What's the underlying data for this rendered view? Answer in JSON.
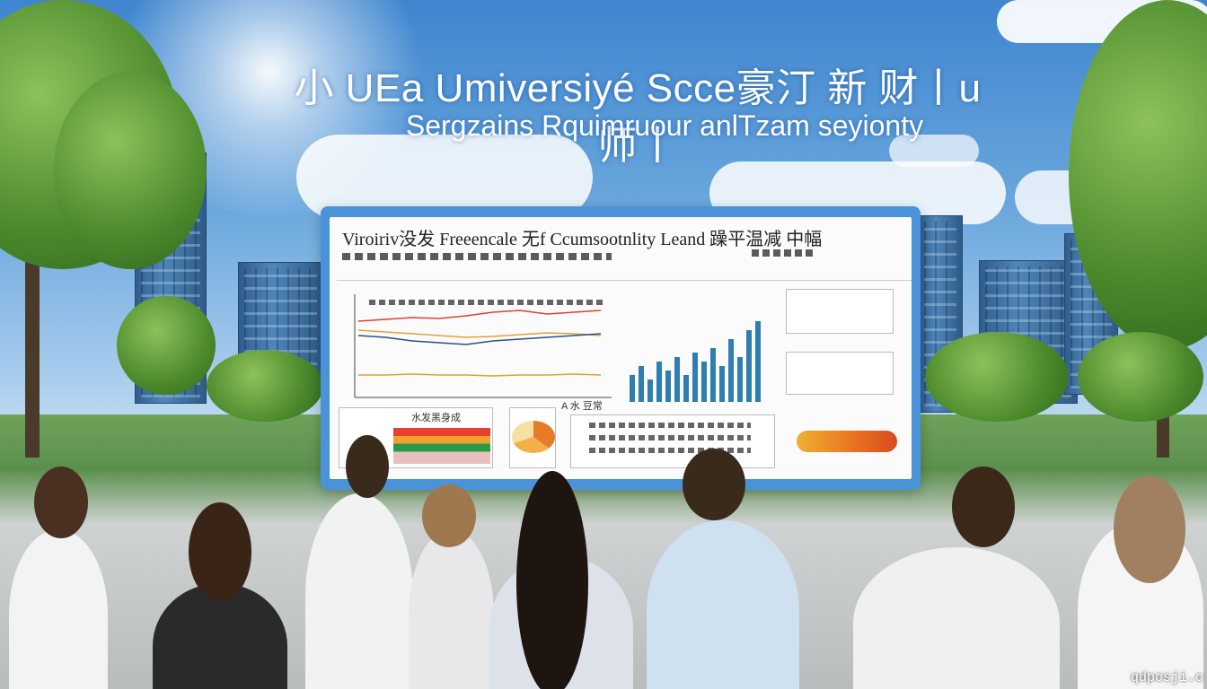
{
  "headline": "小 UEa Umiversiyé Scce豪汀 新 财丨u师丨",
  "subheadline": "Sergzains Rquimruour anlTzam seyionty",
  "board": {
    "heading": "Viroiriv没发 Freeencale 无f Ccumsootnlity  Leand 躁平温减 中幅",
    "panel_bar_label": "水发黑身成",
    "panel_mid_label": "A 水 豆常",
    "line_colors": [
      "#e0402a",
      "#e8a030",
      "#2a4f8a",
      "#d8a820"
    ],
    "bar_color": "#2e7fb0",
    "pie_colors": [
      "#e87a2a",
      "#f3b04a",
      "#f6dfa2"
    ],
    "bar_values": [
      6,
      8,
      5,
      9,
      7,
      10,
      6,
      11,
      9,
      12,
      8,
      14,
      10,
      16,
      18
    ]
  },
  "watermark": "qdposji.c",
  "colors": {
    "sky": "#3f86cf",
    "board_frame": "#4b93d8"
  }
}
